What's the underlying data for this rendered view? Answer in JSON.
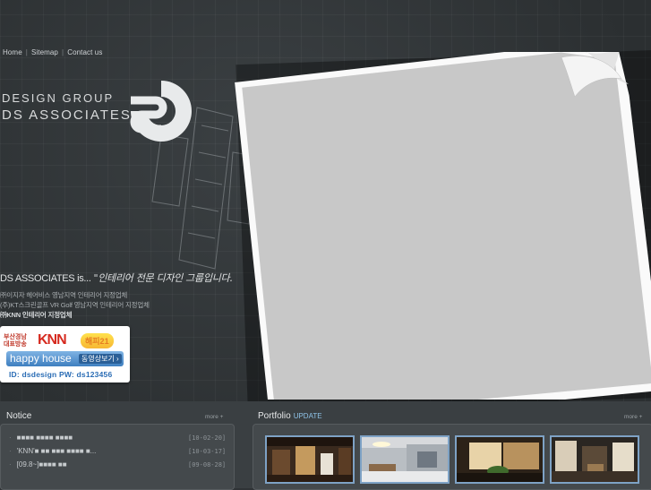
{
  "nav": {
    "home": "Home",
    "sitemap": "Sitemap",
    "contact": "Contact us"
  },
  "brand": {
    "line1": "DESIGN GROUP",
    "line2": "DS ASSOCIATES"
  },
  "tagline": {
    "main": "DS ASSOCIATES is...",
    "script": "\"인테리어 전문 디자인 그룹입니다."
  },
  "subs": [
    "㈜이지자 헤어비스 영남지역 인테리어 지정업체",
    "(주)KT스크린골프 VR Golf 영남지역 인테리어 지정업체",
    "㈜KNN 인테리어 지정업체"
  ],
  "banner": {
    "knn_small": [
      "부산경남",
      "대표방송"
    ],
    "knn": "KNN",
    "badge": "해피21",
    "happy": "happy house",
    "video": "동영상보기 ›",
    "idpw": "ID: dsdesign  PW: ds123456"
  },
  "notice": {
    "title": "Notice",
    "more": "more +",
    "items": [
      {
        "text": "■■■■ ■■■■ ■■■■",
        "date": "[10-02-20]"
      },
      {
        "text": "'KNN'■ ■■ ■■■ ■■■■ ■...",
        "date": "[10-03-17]"
      },
      {
        "text": "[09.8~]■■■■ ■■",
        "date": "[09-08-28]"
      }
    ]
  },
  "portfolio": {
    "title": "Portfolio",
    "update": "UPDATE",
    "more": "more +"
  },
  "colors": {
    "bg": "#2f3336",
    "accent": "#8fc3e8",
    "thumb_border": "#7ea2c5"
  }
}
